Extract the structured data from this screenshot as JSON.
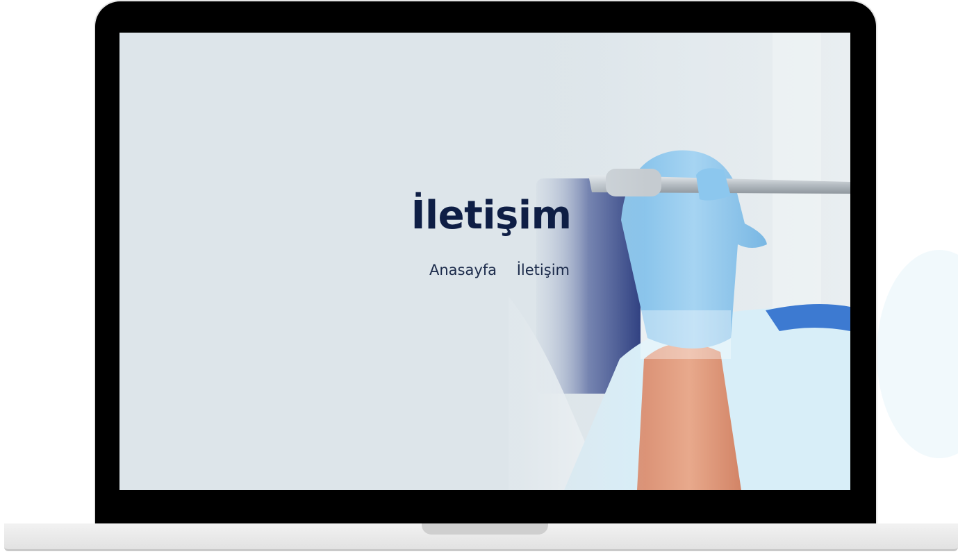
{
  "hero": {
    "title": "İletişim"
  },
  "breadcrumb": {
    "home_label": "Anasayfa",
    "current_label": "İletişim"
  },
  "colors": {
    "title_text": "#0e1e45",
    "screen_background": "#dde5ea",
    "glove": "#8fc6ec",
    "laptop_bezel": "#000000"
  }
}
